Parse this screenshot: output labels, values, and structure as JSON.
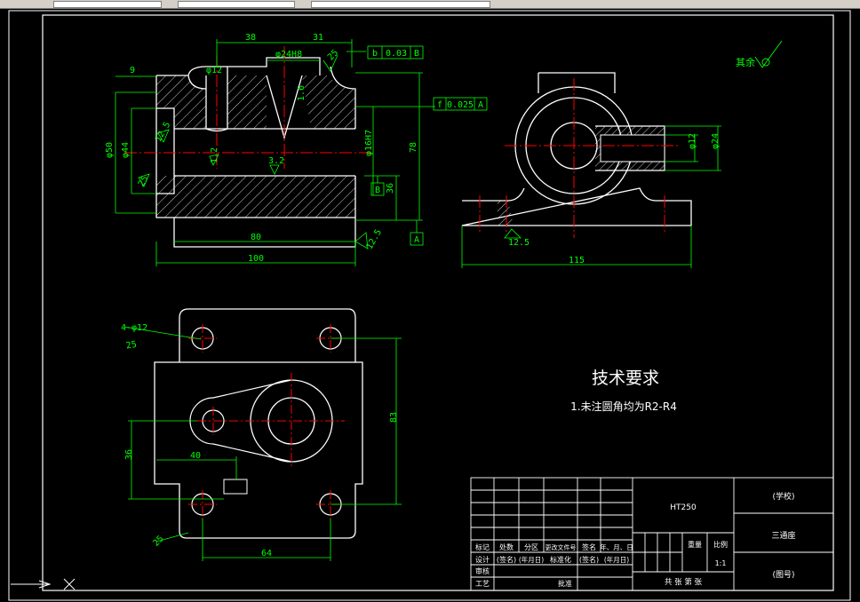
{
  "drawing": {
    "tech_title": "技术要求",
    "tech_note": "1.未注圆角均为R2-R4",
    "surface_other": "其余",
    "front_dims": {
      "d38": "38",
      "d31": "31",
      "d9": "9",
      "phi12": "φ12",
      "phi24": "φ24H8",
      "r25": "25",
      "r16": "1.6",
      "ra32": "3.2",
      "ra125a": "12.5",
      "ra125b": "12.5",
      "phi50": "φ50",
      "phi44": "φ44",
      "r25b": "25",
      "phi16": "φ16H7",
      "d78": "78",
      "d36": "36",
      "d80": "80",
      "d100": "100",
      "ra125c": "12.5",
      "r12": "1.2"
    },
    "tolerance1": {
      "sym": "b",
      "val": "0.03",
      "ref": "B"
    },
    "tolerance2": {
      "sym": "f",
      "val": "0.025",
      "ref": "A"
    },
    "datum_a": "A",
    "datum_b": "B",
    "side_dims": {
      "phi12": "φ12",
      "phi24": "φ24",
      "ra125": "12.5",
      "d115": "115"
    },
    "top_dims": {
      "holes": "4-φ12",
      "holes_depth": "25",
      "d40": "40",
      "d36": "36",
      "d83": "83",
      "d64": "64",
      "ra": "25"
    }
  },
  "title_block": {
    "material": "HT250",
    "school": "(学校)",
    "part_name": "三通座",
    "drawing_no": "(图号)",
    "row_headers": [
      "标记",
      "处数",
      "分区",
      "更改文件号",
      "签名",
      "年、月、日"
    ],
    "row_design": [
      "设计",
      "(签名)",
      "(年月日)",
      "标准化",
      "(签名)",
      "(年月日)"
    ],
    "review": "审核",
    "process": "工艺",
    "approve": "批准",
    "weight": "重量",
    "scale_label": "比例",
    "scale": "1:1",
    "sheets": "共  张  第  张"
  }
}
